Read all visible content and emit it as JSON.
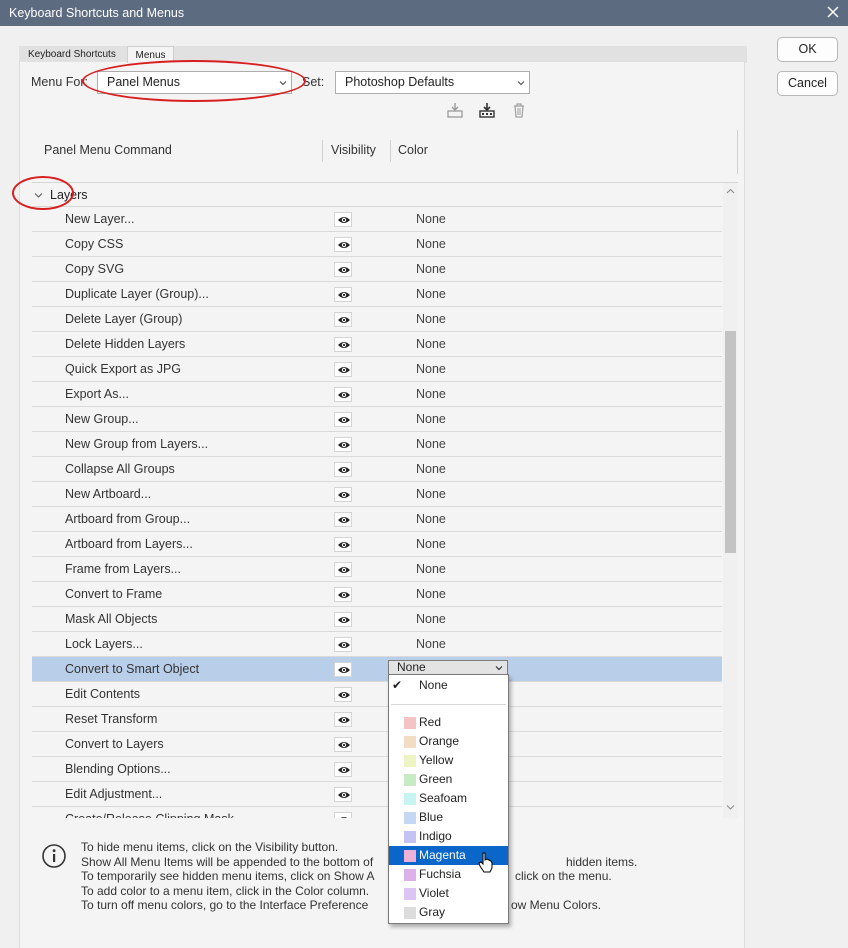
{
  "window": {
    "title": "Keyboard Shortcuts and Menus"
  },
  "tabs": [
    "Keyboard Shortcuts",
    "Menus"
  ],
  "menu_for": {
    "label": "Menu For:",
    "value": "Panel Menus"
  },
  "set": {
    "label": "Set:",
    "value": "Photoshop Defaults"
  },
  "buttons": {
    "ok": "OK",
    "cancel": "Cancel"
  },
  "columns": {
    "command": "Panel Menu Command",
    "visibility": "Visibility",
    "color": "Color"
  },
  "group": {
    "name": "Layers"
  },
  "rows": [
    {
      "cmd": "New Layer...",
      "color": "None"
    },
    {
      "cmd": "Copy CSS",
      "color": "None"
    },
    {
      "cmd": "Copy SVG",
      "color": "None"
    },
    {
      "cmd": "Duplicate Layer (Group)...",
      "color": "None"
    },
    {
      "cmd": "Delete Layer (Group)",
      "color": "None"
    },
    {
      "cmd": "Delete Hidden Layers",
      "color": "None"
    },
    {
      "cmd": "Quick Export as JPG",
      "color": "None"
    },
    {
      "cmd": "Export As...",
      "color": "None"
    },
    {
      "cmd": "New Group...",
      "color": "None"
    },
    {
      "cmd": "New Group from Layers...",
      "color": "None"
    },
    {
      "cmd": "Collapse All Groups",
      "color": "None"
    },
    {
      "cmd": "New Artboard...",
      "color": "None"
    },
    {
      "cmd": "Artboard from Group...",
      "color": "None"
    },
    {
      "cmd": "Artboard from Layers...",
      "color": "None"
    },
    {
      "cmd": "Frame from Layers...",
      "color": "None"
    },
    {
      "cmd": "Convert to Frame",
      "color": "None"
    },
    {
      "cmd": "Mask All Objects",
      "color": "None"
    },
    {
      "cmd": "Lock Layers...",
      "color": "None"
    },
    {
      "cmd": "Convert to Smart Object",
      "color": "None"
    },
    {
      "cmd": "Edit Contents",
      "color": ""
    },
    {
      "cmd": "Reset Transform",
      "color": ""
    },
    {
      "cmd": "Convert to Layers",
      "color": ""
    },
    {
      "cmd": "Blending Options...",
      "color": ""
    },
    {
      "cmd": "Edit Adjustment...",
      "color": ""
    },
    {
      "cmd": "Create/Release Clipping Mask",
      "color": ""
    }
  ],
  "selected_row_color": "None",
  "dropdown": {
    "none": "None",
    "options": [
      {
        "name": "Red",
        "swatch": "#f4c4c4"
      },
      {
        "name": "Orange",
        "swatch": "#f3dcc4"
      },
      {
        "name": "Yellow",
        "swatch": "#eef3c4"
      },
      {
        "name": "Green",
        "swatch": "#c7ecc4"
      },
      {
        "name": "Seafoam",
        "swatch": "#c7f4f0"
      },
      {
        "name": "Blue",
        "swatch": "#c4d8f4"
      },
      {
        "name": "Indigo",
        "swatch": "#c4c4f2"
      },
      {
        "name": "Magenta",
        "swatch": "#eeb0d6"
      },
      {
        "name": "Fuchsia",
        "swatch": "#dcb0e8"
      },
      {
        "name": "Violet",
        "swatch": "#dcc4f4"
      },
      {
        "name": "Gray",
        "swatch": "#dcdcdc"
      }
    ],
    "highlighted": "Magenta"
  },
  "help": [
    "To hide menu items, click on the Visibility button.",
    "Show All Menu Items will be appended to the bottom of",
    "To temporarily see hidden menu items, click on Show A",
    "To add color to a menu item, click in the Color column.",
    "To turn off menu colors, go to the Interface Preference"
  ],
  "help_right": [
    "",
    "hidden items.",
    "click on the menu.",
    "",
    "ow Menu Colors."
  ],
  "colors": {
    "titlebar": "#5c6b80",
    "selected_row": "#b9cfe9",
    "highlight": "#0a66c8",
    "annotation": "#d81f1f"
  }
}
